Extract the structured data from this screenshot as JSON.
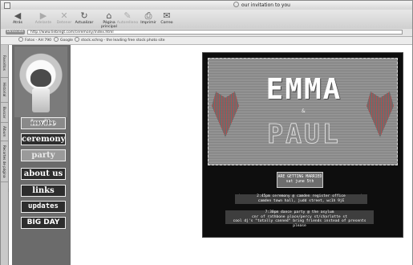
{
  "window": {
    "title": "our invitation to you"
  },
  "toolbar": {
    "buttons": [
      {
        "label": "Atrás",
        "icon": "◀"
      },
      {
        "label": "Adelante",
        "icon": "▶"
      },
      {
        "label": "Detener",
        "icon": "✕"
      },
      {
        "label": "Actualizar",
        "icon": "↻"
      },
      {
        "label": "Página principal",
        "icon": "⌂"
      },
      {
        "label": "Autorelleno",
        "icon": "✎"
      },
      {
        "label": "Imprimir",
        "icon": "⎙"
      },
      {
        "label": "Correo",
        "icon": "✉"
      }
    ]
  },
  "address": {
    "label": "Dirección",
    "url": "http://www.liebregt.com/ceremony/index.html"
  },
  "favorites": [
    {
      "label": "Fotos - AH 790"
    },
    {
      "label": "Google"
    },
    {
      "label": "stock.xchng - the leading free stock photo site"
    }
  ],
  "sidetabs": [
    "Favoritos",
    "Historial",
    "Buscar",
    "Álbum",
    "Recortes de página"
  ],
  "nav": {
    "items": [
      "invite",
      "ceremony",
      "party",
      "about us",
      "links",
      "updates",
      "BIG DAY"
    ]
  },
  "poster": {
    "name1": "EMMA",
    "amp": "&",
    "name2": "PAUL",
    "badge_line1": "ARE GETTING MARRIED",
    "badge_line2": "sat june 5th",
    "ceremony": "2:45pm ceremony @ camden register office",
    "ceremony_addr": "camden town hall, judd street, wc1h 9jE",
    "party": "7:30pm dance party @ the asylum",
    "party_addr": "cnr of rathbone place/percy st/charlotte st",
    "party_note": "cool dj's \"totally canned\" bring friends instead of presents please",
    "markers": [
      "*",
      "*",
      "¤",
      "¤"
    ]
  },
  "colors": {
    "page_bg": "#ffffff",
    "nav_bg": "#6b6b6b",
    "poster_bg": "#0e0e0e",
    "accent": "#b54545"
  }
}
